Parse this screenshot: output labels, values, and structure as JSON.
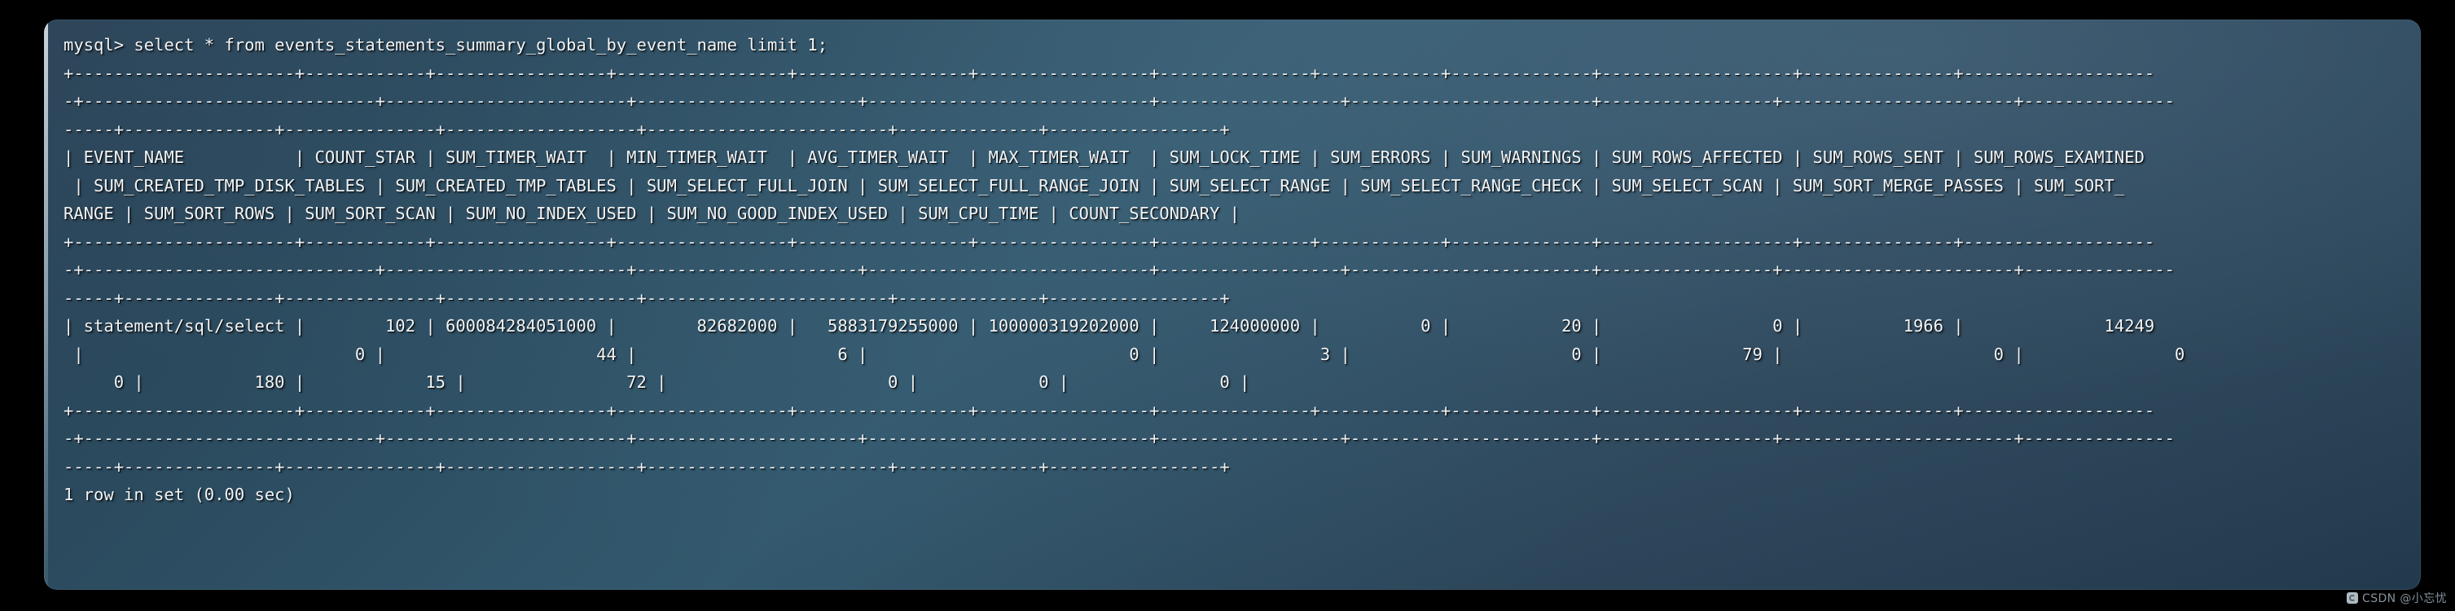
{
  "window": {
    "title": "mysql-terminal",
    "background_color": "#000000",
    "panel_color": "#2d4a5e",
    "text_color": "#f2f5f7"
  },
  "terminal": {
    "prompt": "mysql>",
    "command": "select * from events_statements_summary_global_by_event_name limit 1;",
    "prompt_line": "mysql> select * from events_statements_summary_global_by_event_name limit 1;",
    "result_footer": "1 row in set (0.00 sec)",
    "row_count": 1,
    "elapsed": "0.00 sec",
    "table_name": "events_statements_summary_global_by_event_name",
    "limit": 1,
    "columns": [
      "EVENT_NAME",
      "COUNT_STAR",
      "SUM_TIMER_WAIT",
      "MIN_TIMER_WAIT",
      "AVG_TIMER_WAIT",
      "MAX_TIMER_WAIT",
      "SUM_LOCK_TIME",
      "SUM_ERRORS",
      "SUM_WARNINGS",
      "SUM_ROWS_AFFECTED",
      "SUM_ROWS_SENT",
      "SUM_ROWS_EXAMINED",
      "SUM_CREATED_TMP_DISK_TABLES",
      "SUM_CREATED_TMP_TABLES",
      "SUM_SELECT_FULL_JOIN",
      "SUM_SELECT_FULL_RANGE_JOIN",
      "SUM_SELECT_RANGE",
      "SUM_SELECT_RANGE_CHECK",
      "SUM_SELECT_SCAN",
      "SUM_SORT_MERGE_PASSES",
      "SUM_SORT_RANGE",
      "SUM_SORT_ROWS",
      "SUM_SORT_SCAN",
      "SUM_NO_INDEX_USED",
      "SUM_NO_GOOD_INDEX_USED",
      "SUM_CPU_TIME",
      "COUNT_SECONDARY"
    ],
    "rows": [
      {
        "EVENT_NAME": "statement/sql/select",
        "COUNT_STAR": "102",
        "SUM_TIMER_WAIT": "600084284051000",
        "MIN_TIMER_WAIT": "82682000",
        "AVG_TIMER_WAIT": "5883179255000",
        "MAX_TIMER_WAIT": "100000319202000",
        "SUM_LOCK_TIME": "124000000",
        "SUM_ERRORS": "0",
        "SUM_WARNINGS": "20",
        "SUM_ROWS_AFFECTED": "0",
        "SUM_ROWS_SENT": "1966",
        "SUM_ROWS_EXAMINED": "14249",
        "SUM_CREATED_TMP_DISK_TABLES": "0",
        "SUM_CREATED_TMP_TABLES": "44",
        "SUM_SELECT_FULL_JOIN": "6",
        "SUM_SELECT_FULL_RANGE_JOIN": "0",
        "SUM_SELECT_RANGE": "3",
        "SUM_SELECT_RANGE_CHECK": "0",
        "SUM_SELECT_SCAN": "79",
        "SUM_SORT_MERGE_PASSES": "0",
        "SUM_SORT_RANGE": "0",
        "SUM_SORT_ROWS": "180",
        "SUM_SORT_SCAN": "15",
        "SUM_NO_INDEX_USED": "72",
        "SUM_NO_GOOD_INDEX_USED": "0",
        "SUM_CPU_TIME": "0",
        "COUNT_SECONDARY": "0"
      }
    ],
    "lines": {
      "prompt": "mysql> select * from events_statements_summary_global_by_event_name limit 1;",
      "rule_top_a": "+----------------------+------------+-----------------+-----------------+-----------------+-----------------+---------------+------------+--------------+-------------------+---------------+-------------------",
      "rule_top_b": "-+-----------------------------+------------------------+----------------------+----------------------------+------------------+------------------------+-----------------+-----------------------+---------------",
      "rule_top_c": "-----+---------------+---------------+-------------------+------------------------+--------------+-----------------+",
      "header_a": "| EVENT_NAME           | COUNT_STAR | SUM_TIMER_WAIT  | MIN_TIMER_WAIT  | AVG_TIMER_WAIT  | MAX_TIMER_WAIT  | SUM_LOCK_TIME | SUM_ERRORS | SUM_WARNINGS | SUM_ROWS_AFFECTED | SUM_ROWS_SENT | SUM_ROWS_EXAMINED",
      "header_b": " | SUM_CREATED_TMP_DISK_TABLES | SUM_CREATED_TMP_TABLES | SUM_SELECT_FULL_JOIN | SUM_SELECT_FULL_RANGE_JOIN | SUM_SELECT_RANGE | SUM_SELECT_RANGE_CHECK | SUM_SELECT_SCAN | SUM_SORT_MERGE_PASSES | SUM_SORT_",
      "header_c": "RANGE | SUM_SORT_ROWS | SUM_SORT_SCAN | SUM_NO_INDEX_USED | SUM_NO_GOOD_INDEX_USED | SUM_CPU_TIME | COUNT_SECONDARY |",
      "rule_mid_a": "+----------------------+------------+-----------------+-----------------+-----------------+-----------------+---------------+------------+--------------+-------------------+---------------+-------------------",
      "rule_mid_b": "-+-----------------------------+------------------------+----------------------+----------------------------+------------------+------------------------+-----------------+-----------------------+---------------",
      "rule_mid_c": "-----+---------------+---------------+-------------------+------------------------+--------------+-----------------+",
      "data_a": "| statement/sql/select |        102 | 600084284051000 |        82682000 |   5883179255000 | 100000319202000 |     124000000 |          0 |           20 |                 0 |          1966 |              14249",
      "data_b": " |                           0 |                     44 |                    6 |                          0 |                3 |                      0 |              79 |                     0 |               0",
      "data_c": "     0 |           180 |            15 |                72 |                      0 |            0 |               0 |",
      "rule_bot_a": "+----------------------+------------+-----------------+-----------------+-----------------+-----------------+---------------+------------+--------------+-------------------+---------------+-------------------",
      "rule_bot_b": "-+-----------------------------+------------------------+----------------------+----------------------------+------------------+------------------------+-----------------+-----------------------+---------------",
      "rule_bot_c": "-----+---------------+---------------+-------------------+------------------------+--------------+-----------------+",
      "footer": "1 row in set (0.00 sec)"
    }
  },
  "watermark": {
    "text": "CSDN @小忘忧",
    "logo_icon": "csdn-logo-icon"
  }
}
